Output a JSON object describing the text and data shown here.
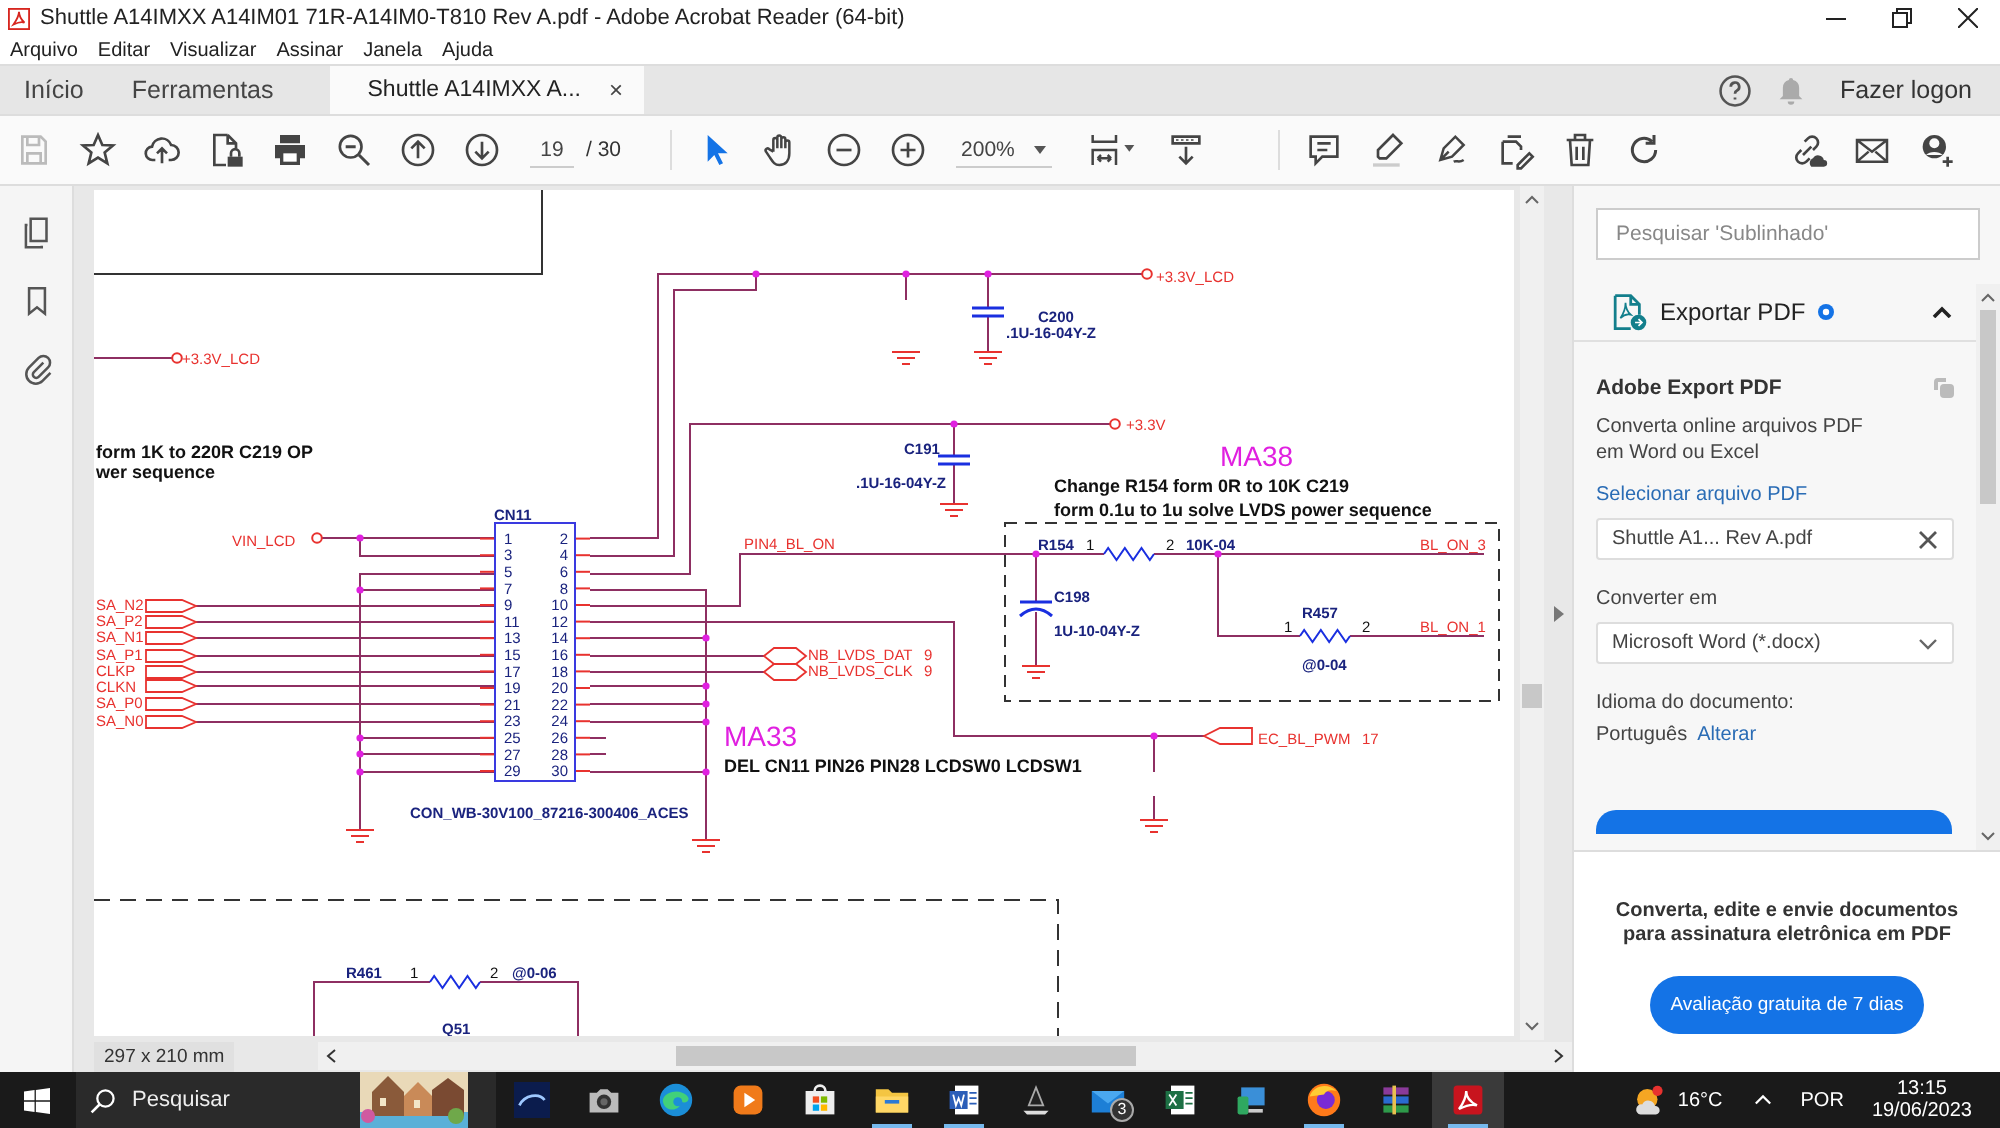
{
  "window": {
    "title": "Shuttle A14IMXX A14IM01 71R-A14IM0-T810 Rev A.pdf - Adobe Acrobat Reader (64-bit)"
  },
  "menu": [
    "Arquivo",
    "Editar",
    "Visualizar",
    "Assinar",
    "Janela",
    "Ajuda"
  ],
  "tabs": [
    {
      "label": "Início",
      "selected": false
    },
    {
      "label": "Ferramentas",
      "selected": false
    },
    {
      "label": "Shuttle A14IMXX A...",
      "selected": true,
      "close": "×"
    }
  ],
  "account": {
    "label": "Fazer logon"
  },
  "toolbar": {
    "save_disabled": true,
    "page": "19",
    "page_count": "/ 30",
    "zoom": "200%",
    "select_selected": true,
    "hand_selected": false
  },
  "schematic": {
    "connector": {
      "name": "CN11",
      "left_pins": [
        "1",
        "3",
        "5",
        "7",
        "9",
        "11",
        "13",
        "15",
        "17",
        "19",
        "21",
        "23",
        "25",
        "27",
        "29"
      ],
      "right_pins": [
        "2",
        "4",
        "6",
        "8",
        "10",
        "12",
        "14",
        "16",
        "18",
        "20",
        "22",
        "24",
        "26",
        "28",
        "30"
      ]
    },
    "texts": [
      {
        "text": "+3.3V_LCD",
        "kind": "net"
      },
      {
        "text": "form 1K to 220R C219 OP",
        "kind": "note"
      },
      {
        "text": "wer sequence",
        "kind": "note"
      },
      {
        "text": "VIN_LCD",
        "kind": "net"
      },
      {
        "text": "SA_N2",
        "kind": "net"
      },
      {
        "text": "SA_P2",
        "kind": "net"
      },
      {
        "text": "SA_N1",
        "kind": "net"
      },
      {
        "text": "SA_P1",
        "kind": "net"
      },
      {
        "text": "CLKP",
        "kind": "net"
      },
      {
        "text": "CLKN",
        "kind": "net"
      },
      {
        "text": "SA_P0",
        "kind": "net"
      },
      {
        "text": "SA_N0",
        "kind": "net"
      },
      {
        "text": "CON_WB-30V100_87216-300406_ACES",
        "kind": "part"
      },
      {
        "text": "MA33",
        "kind": "marker"
      },
      {
        "text": "DEL CN11 PIN26 PIN28 LCDSW0 LCDSW1",
        "kind": "note"
      },
      {
        "text": "+3.3V_LCD",
        "kind": "net"
      },
      {
        "text": "C200",
        "kind": "part"
      },
      {
        "text": ".1U-16-04Y-Z",
        "kind": "part"
      },
      {
        "text": "+3.3V",
        "kind": "net"
      },
      {
        "text": "C191",
        "kind": "part"
      },
      {
        "text": ".1U-16-04Y-Z",
        "kind": "part"
      },
      {
        "text": "MA38",
        "kind": "marker"
      },
      {
        "text": "Change R154  form 0R to 10K C219",
        "kind": "note"
      },
      {
        "text": "form 0.1u to 1u solve LVDS power sequence",
        "kind": "note"
      },
      {
        "text": "PIN4_BL_ON",
        "kind": "net"
      },
      {
        "text": "R154",
        "kind": "part"
      },
      {
        "text": "1",
        "kind": "pin"
      },
      {
        "text": "2",
        "kind": "pin"
      },
      {
        "text": "10K-04",
        "kind": "part"
      },
      {
        "text": "BL_ON_3",
        "kind": "net"
      },
      {
        "text": "C198",
        "kind": "part"
      },
      {
        "text": "1U-10-04Y-Z",
        "kind": "part"
      },
      {
        "text": "R457",
        "kind": "part"
      },
      {
        "text": "1",
        "kind": "pin"
      },
      {
        "text": "2",
        "kind": "pin"
      },
      {
        "text": "BL_ON_1",
        "kind": "net"
      },
      {
        "text": "@0-04",
        "kind": "part"
      },
      {
        "text": "NB_LVDS_DAT",
        "kind": "net"
      },
      {
        "text": "9",
        "kind": "net"
      },
      {
        "text": "NB_LVDS_CLK",
        "kind": "net"
      },
      {
        "text": "9",
        "kind": "net"
      },
      {
        "text": "EC_BL_PWM",
        "kind": "net"
      },
      {
        "text": "17",
        "kind": "net"
      },
      {
        "text": "R461",
        "kind": "part"
      },
      {
        "text": "1",
        "kind": "pin"
      },
      {
        "text": "2",
        "kind": "pin"
      },
      {
        "text": "@0-06",
        "kind": "part"
      },
      {
        "text": "Q51",
        "kind": "part"
      }
    ]
  },
  "status": {
    "page_size": "297 x 210 mm"
  },
  "panel": {
    "search": {
      "placeholder": "Pesquisar 'Sublinhado'"
    },
    "section": {
      "title": "Exportar PDF",
      "expanded": true
    },
    "heading": "Adobe Export PDF",
    "description": "Converta online arquivos PDF em Word ou Excel",
    "select_link": "Selecionar arquivo PDF",
    "file": {
      "value": "Shuttle A1... Rev A.pdf"
    },
    "convert_label": "Converter em",
    "format": {
      "value": "Microsoft Word (*.docx)"
    },
    "language_label": "Idioma do documento:",
    "language": "Português",
    "change_link": "Alterar",
    "promo": {
      "text": "Converta, edite e envie documentos para assinatura eletrônica em PDF",
      "button": "Avaliação gratuita de 7 dias"
    }
  },
  "taskbar": {
    "search": {
      "placeholder": "Pesquisar"
    },
    "apps": [
      {
        "running": false,
        "active": false
      },
      {
        "running": false,
        "active": false
      },
      {
        "running": false,
        "active": false
      },
      {
        "running": false,
        "active": false
      },
      {
        "running": false,
        "active": false
      },
      {
        "running": true,
        "active": false
      },
      {
        "running": true,
        "active": false
      },
      {
        "running": false,
        "active": false
      },
      {
        "running": false,
        "active": false,
        "badge": "3"
      },
      {
        "running": false,
        "active": false
      },
      {
        "running": false,
        "active": false
      },
      {
        "running": true,
        "active": false
      },
      {
        "running": false,
        "active": false
      },
      {
        "running": true,
        "active": true
      }
    ],
    "weather": "16°C",
    "language": "POR",
    "time": "13:15",
    "date": "19/06/2023"
  }
}
